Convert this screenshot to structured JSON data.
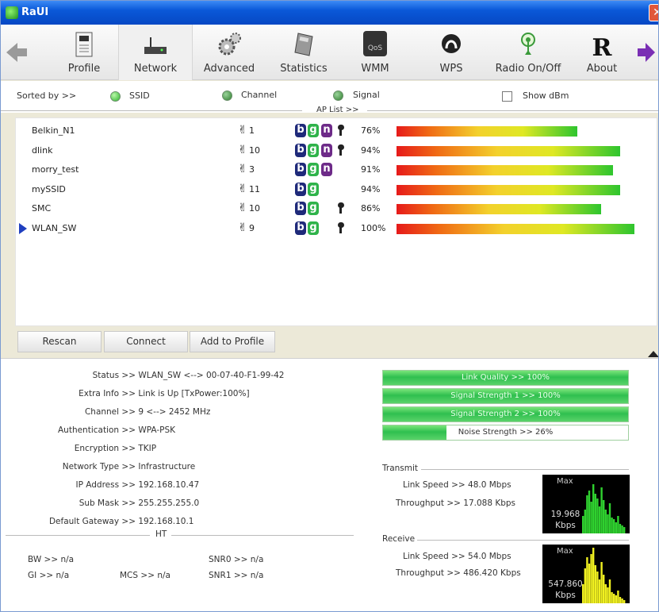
{
  "window": {
    "title": "RaUI"
  },
  "toolbar": {
    "items": [
      {
        "label": "Profile"
      },
      {
        "label": "Network"
      },
      {
        "label": "Advanced"
      },
      {
        "label": "Statistics"
      },
      {
        "label": "WMM"
      },
      {
        "label": "WPS"
      },
      {
        "label": "Radio On/Off"
      },
      {
        "label": "About"
      }
    ],
    "wmm_icon_text": "QoS"
  },
  "sort": {
    "label": "Sorted by >>",
    "ssid": "SSID",
    "channel": "Channel",
    "signal": "Signal",
    "show_dbm": "Show dBm",
    "aplist_title": "AP List >>"
  },
  "aps": [
    {
      "ssid": "Belkin_N1",
      "channel": "1",
      "b": "b",
      "g": "g",
      "n": "n",
      "lock": true,
      "signal": "76%",
      "level": 76,
      "selected": false
    },
    {
      "ssid": "dlink",
      "channel": "10",
      "b": "b",
      "g": "g",
      "n": "n",
      "lock": true,
      "signal": "94%",
      "level": 94,
      "selected": false
    },
    {
      "ssid": "morry_test",
      "channel": "3",
      "b": "b",
      "g": "g",
      "n": "n",
      "lock": false,
      "signal": "91%",
      "level": 91,
      "selected": false
    },
    {
      "ssid": "mySSID",
      "channel": "11",
      "b": "b",
      "g": "g",
      "n": "",
      "lock": false,
      "signal": "94%",
      "level": 94,
      "selected": false
    },
    {
      "ssid": "SMC",
      "channel": "10",
      "b": "b",
      "g": "g",
      "n": "",
      "lock": true,
      "signal": "86%",
      "level": 86,
      "selected": false
    },
    {
      "ssid": "WLAN_SW",
      "channel": "9",
      "b": "b",
      "g": "g",
      "n": "",
      "lock": true,
      "signal": "100%",
      "level": 100,
      "selected": true
    }
  ],
  "buttons": {
    "rescan": "Rescan",
    "connect": "Connect",
    "add_profile": "Add to Profile"
  },
  "info": {
    "status_k": "Status >>",
    "status_v": "WLAN_SW <--> 00-07-40-F1-99-42",
    "extra_k": "Extra Info >>",
    "extra_v": "Link is Up [TxPower:100%]",
    "channel_k": "Channel >>",
    "channel_v": "9 <--> 2452 MHz",
    "auth_k": "Authentication >>",
    "auth_v": "WPA-PSK",
    "enc_k": "Encryption >>",
    "enc_v": "TKIP",
    "nettype_k": "Network Type >>",
    "nettype_v": "Infrastructure",
    "ip_k": "IP Address >>",
    "ip_v": "192.168.10.47",
    "mask_k": "Sub Mask >>",
    "mask_v": "255.255.255.0",
    "gw_k": "Default Gateway >>",
    "gw_v": "192.168.10.1",
    "ht_title": "HT",
    "bw": "BW >> n/a",
    "gi": "GI >> n/a",
    "mcs": "MCS >> n/a",
    "snr0": "SNR0 >> n/a",
    "snr1": "SNR1 >> n/a"
  },
  "meters": [
    {
      "label": "Link Quality >> 100%",
      "level": 100
    },
    {
      "label": "Signal Strength 1 >> 100%",
      "level": 100
    },
    {
      "label": "Signal Strength 2 >> 100%",
      "level": 100
    },
    {
      "label": "Noise Strength >> 26%",
      "level": 26
    }
  ],
  "transmit": {
    "title": "Transmit",
    "link_speed": "Link Speed >> 48.0 Mbps",
    "throughput": "Throughput >> 17.088 Kbps",
    "graph_max": "Max",
    "graph_value": "19.968",
    "graph_unit": "Kbps",
    "graph_color": "#2fd12f"
  },
  "receive": {
    "title": "Receive",
    "link_speed": "Link Speed >> 54.0 Mbps",
    "throughput": "Throughput >> 486.420 Kbps",
    "graph_max": "Max",
    "graph_value": "547.860",
    "graph_unit": "Kbps",
    "graph_color": "#f0f020"
  }
}
